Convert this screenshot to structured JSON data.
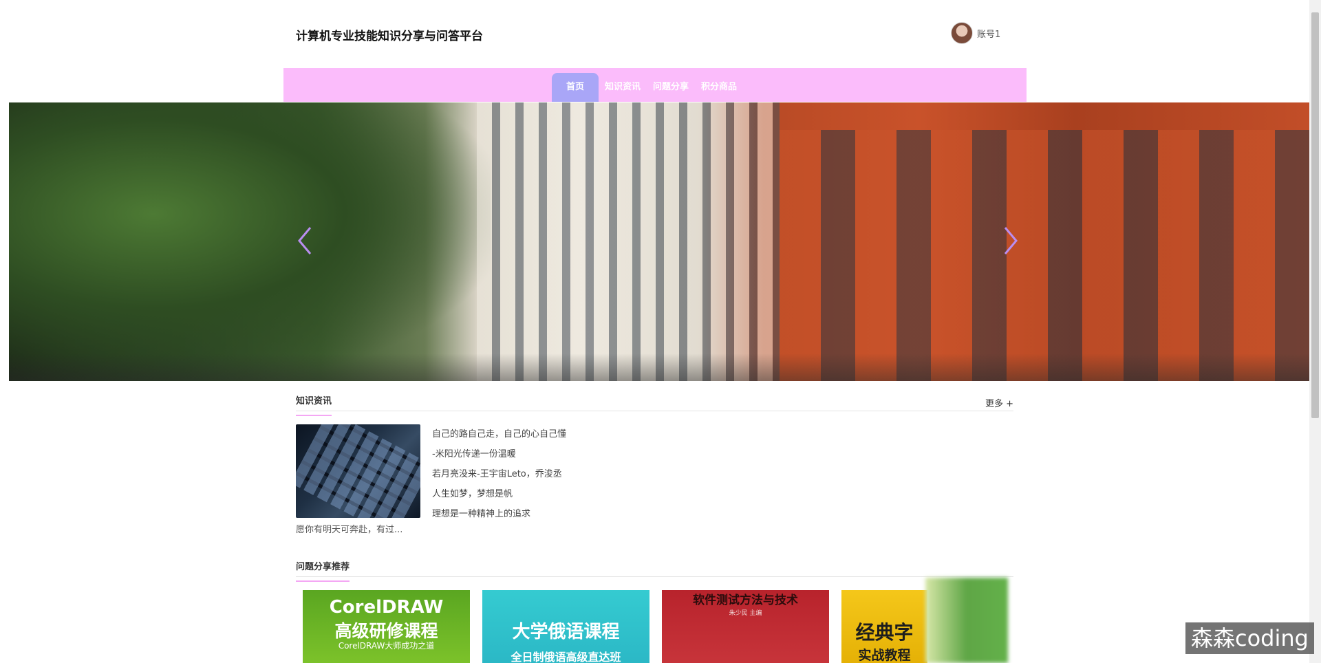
{
  "header": {
    "site_title": "计算机专业技能知识分享与问答平台",
    "account_name": "账号1"
  },
  "nav": {
    "items": [
      {
        "label": "首页",
        "active": true
      },
      {
        "label": "知识资讯",
        "active": false
      },
      {
        "label": "问题分享",
        "active": false
      },
      {
        "label": "积分商品",
        "active": false
      }
    ]
  },
  "banner": {
    "prev_icon": "chevron-left-icon",
    "next_icon": "chevron-right-icon"
  },
  "news_section": {
    "title": "知识资讯",
    "more_label": "更多 +",
    "items": [
      "自己的路自己走，自己的心自己懂",
      "-米阳光传递一份温暖",
      "若月亮没来-王宇宙Leto，乔浚丞",
      "人生如梦，梦想是帆",
      "理想是一种精神上的追求"
    ],
    "featured_desc": "愿你有明天可奔赴，有过..."
  },
  "questions_section": {
    "title": "问题分享推荐",
    "cards": [
      {
        "line1": "CorelDRAW",
        "line2": "高级研修课程",
        "line3": "CorelDRAW大师成功之道"
      },
      {
        "line1": "大学俄语课程",
        "line2": "全日制俄语高级直达班"
      },
      {
        "line1": "软件测试方法与技术",
        "line2": "朱少民 主编"
      },
      {
        "line1": "经典字",
        "line2": "实战教程"
      }
    ]
  },
  "watermark": "森森coding",
  "colors": {
    "nav_bg": "#fbbcfb",
    "nav_active": "#a9a6f7",
    "section_underline": "#f4a7f4"
  }
}
